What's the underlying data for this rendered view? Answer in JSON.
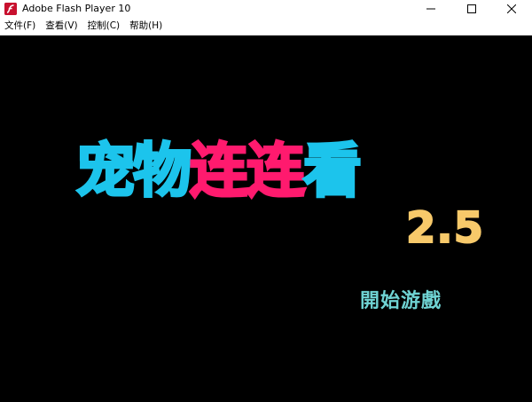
{
  "window": {
    "title": "Adobe Flash Player 10"
  },
  "menu": {
    "items": [
      {
        "label": "文件(F)"
      },
      {
        "label": "查看(V)"
      },
      {
        "label": "控制(C)"
      },
      {
        "label": "帮助(H)"
      }
    ]
  },
  "game": {
    "title_part_1": "宠物",
    "title_part_2": "连连",
    "title_part_3": "看",
    "version": "2.5",
    "start_button": "開始游戲"
  },
  "colors": {
    "stage_background": "#000000",
    "title_cyan": "#1cc4ec",
    "title_pink": "#ff1a6e",
    "version_gold": "#f7c96a",
    "start_teal": "#6fd3d3",
    "flash_red": "#c8102e"
  },
  "icons": {
    "app": "flash-player-icon",
    "minimize": "minimize-icon",
    "maximize": "maximize-icon",
    "close": "close-icon"
  }
}
